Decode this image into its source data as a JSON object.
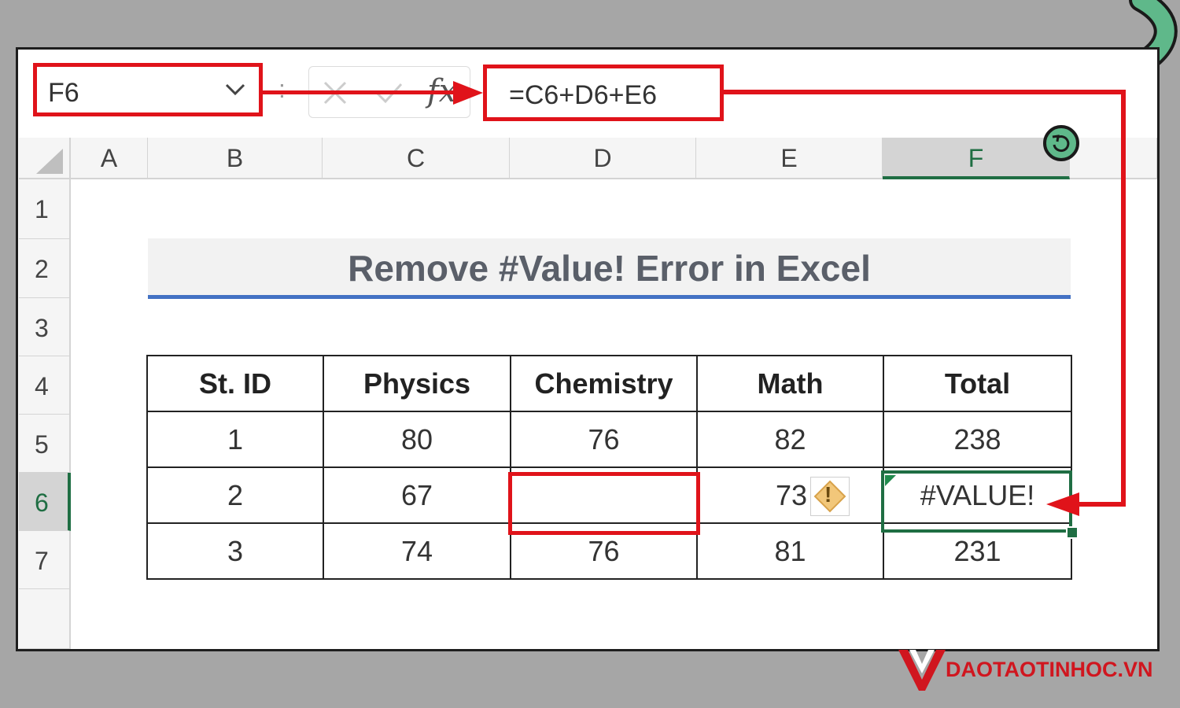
{
  "formula_bar": {
    "name_box_value": "F6",
    "formula": "=C6+D6+E6",
    "colon_glyph": ":",
    "fx_label": "fx"
  },
  "grid": {
    "columns": [
      "A",
      "B",
      "C",
      "D",
      "E",
      "F"
    ],
    "selected_column": "F",
    "rows": [
      "1",
      "2",
      "3",
      "4",
      "5",
      "6",
      "7"
    ],
    "selected_row": "6"
  },
  "sheet": {
    "title": "Remove #Value! Error in Excel",
    "table": {
      "headers": [
        "St. ID",
        "Physics",
        "Chemistry",
        "Math",
        "Total"
      ],
      "rows": [
        [
          "1",
          "80",
          "76",
          "82",
          "238"
        ],
        [
          "2",
          "67",
          "",
          "73",
          "#VALUE!"
        ],
        [
          "3",
          "74",
          "76",
          "81",
          "231"
        ]
      ]
    },
    "error_indicator_glyph": "!"
  },
  "watermark": {
    "text": "DAOTAOTINHOC.VN"
  },
  "colors": {
    "annotation_red": "#e0131a",
    "selection_green": "#1f6e43",
    "title_underline": "#4472c4",
    "watermark_red": "#d0161f",
    "decoration_green": "#5fb88a"
  }
}
